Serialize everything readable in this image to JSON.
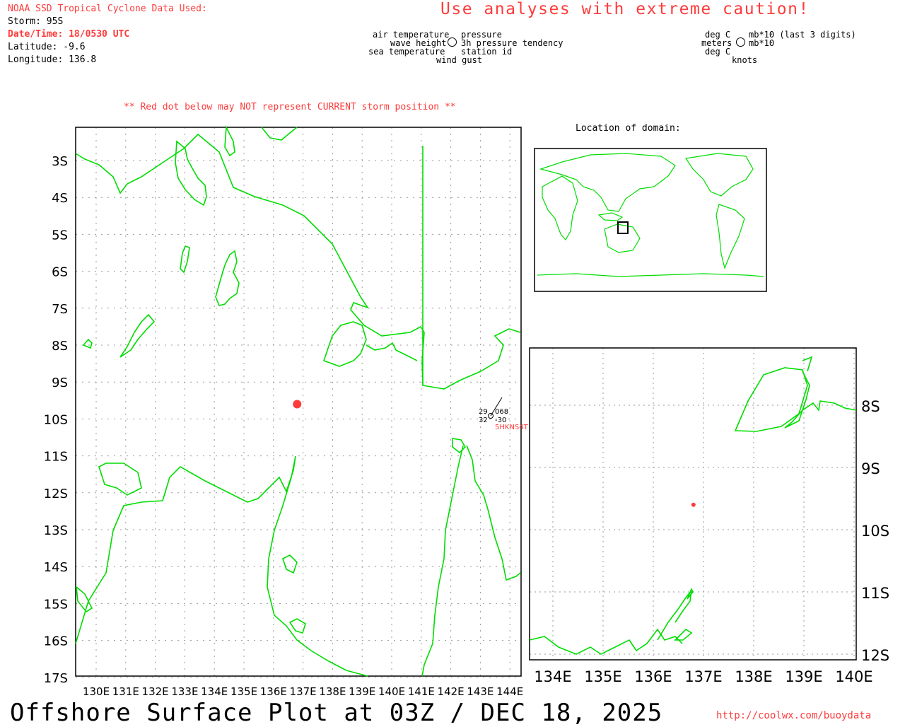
{
  "header": {
    "source": "NOAA SSD Tropical Cyclone Data Used:",
    "storm": "Storm: 95S",
    "datetime": "Date/Time: 18/0530 UTC",
    "latitude": "Latitude: -9.6",
    "longitude": "Longitude: 136.8",
    "caution": "Use analyses with extreme caution!"
  },
  "legend": {
    "left": {
      "air_temperature": "air temperature",
      "wave_height": "wave height",
      "sea_temperature": "sea temperature",
      "pressure": "pressure",
      "pressure_tendency": "3h pressure tendency",
      "station_id": "station id",
      "wind_gust": "wind gust"
    },
    "right": {
      "deg_c_top": "deg C",
      "meters": "meters",
      "deg_c_bottom": "deg C",
      "mb_last3": "mb*10 (last 3 digits)",
      "mb10": "mb*10",
      "knots": "knots"
    }
  },
  "note": "** Red dot below may NOT represent CURRENT storm position **",
  "main_map": {
    "lat_labels": [
      "3S",
      "4S",
      "5S",
      "6S",
      "7S",
      "8S",
      "9S",
      "10S",
      "11S",
      "12S",
      "13S",
      "14S",
      "15S",
      "16S",
      "17S"
    ],
    "lon_labels": [
      "130E",
      "131E",
      "132E",
      "133E",
      "134E",
      "135E",
      "136E",
      "137E",
      "138E",
      "139E",
      "140E",
      "141E",
      "142E",
      "143E",
      "144E"
    ],
    "storm_lat": -9.6,
    "storm_lon": 136.8,
    "station": {
      "air_temp": "29",
      "pressure": "068",
      "sea_temp": "32",
      "tendency": "-30",
      "id": "5HKNS4T"
    }
  },
  "inset_world": {
    "title": "Location of domain:"
  },
  "inset_zoom": {
    "lat_labels": [
      "8S",
      "9S",
      "10S",
      "11S",
      "12S"
    ],
    "lon_labels": [
      "134E",
      "135E",
      "136E",
      "137E",
      "138E",
      "139E",
      "140E"
    ]
  },
  "footer": {
    "title": "Offshore Surface Plot at 03Z / DEC 18, 2025",
    "url": "http://coolwx.com/buoydata"
  },
  "colors": {
    "coast": "#00dd00",
    "accent_red": "#ff3b3b",
    "grid": "#999999"
  }
}
